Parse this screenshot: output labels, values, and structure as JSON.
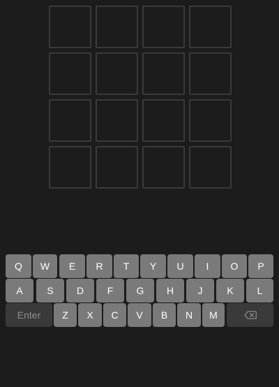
{
  "board": {
    "rows": 4,
    "cols": 4,
    "tiles": [
      [
        "",
        "",
        "",
        ""
      ],
      [
        "",
        "",
        "",
        ""
      ],
      [
        "",
        "",
        "",
        ""
      ],
      [
        "",
        "",
        "",
        ""
      ]
    ]
  },
  "keyboard": {
    "row1": [
      "Q",
      "W",
      "E",
      "R",
      "T",
      "Y",
      "U",
      "I",
      "O",
      "P"
    ],
    "row2": [
      "A",
      "S",
      "D",
      "F",
      "G",
      "H",
      "J",
      "K",
      "L"
    ],
    "row3": [
      "Z",
      "X",
      "C",
      "V",
      "B",
      "N",
      "M"
    ],
    "enter_label": "Enter",
    "backspace_icon": "backspace-icon"
  },
  "colors": {
    "background": "#1c1c1c",
    "tile_border": "#3a3a3a",
    "key": "#7a7a7a",
    "action_key": "#3a3a3a"
  }
}
